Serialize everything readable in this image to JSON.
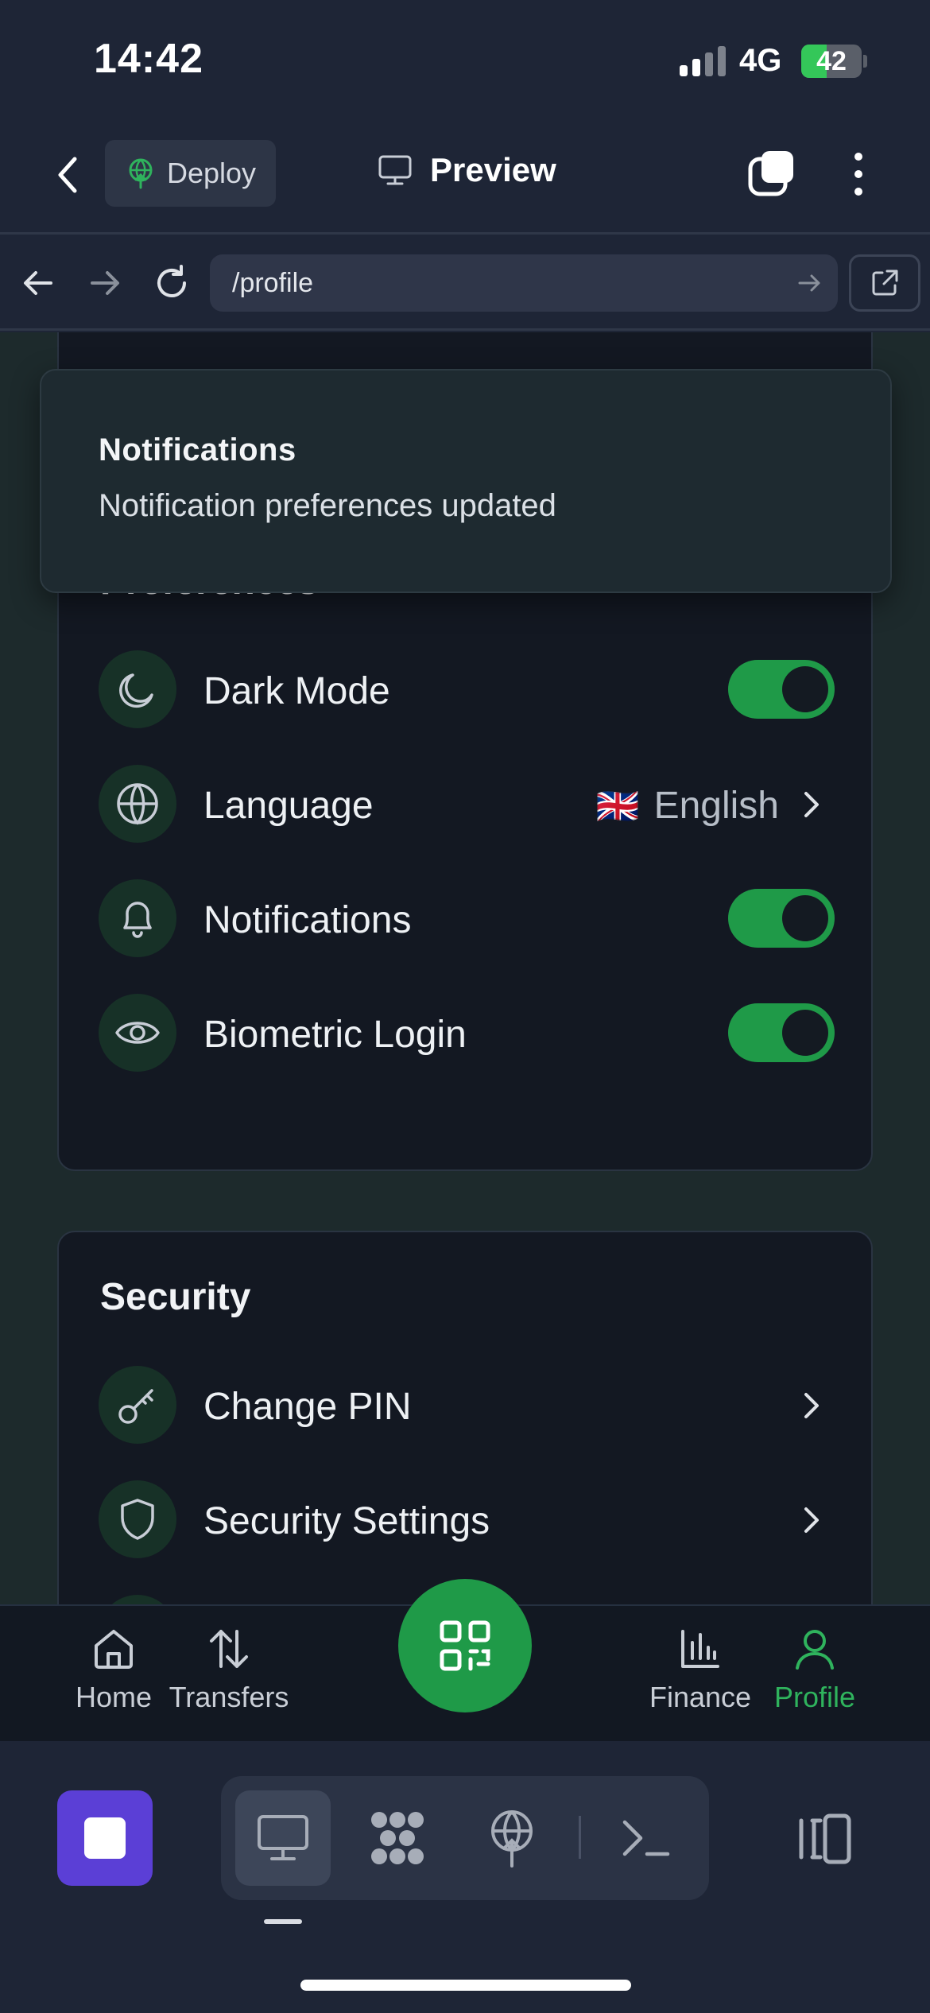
{
  "status_bar": {
    "time": "14:42",
    "network": "4G",
    "battery": "42"
  },
  "header": {
    "deploy_label": "Deploy",
    "preview_label": "Preview"
  },
  "browser": {
    "url": "/profile"
  },
  "toast": {
    "title": "Notifications",
    "message": "Notification preferences updated"
  },
  "preferences": {
    "title": "Preferences",
    "items": [
      {
        "label": "Dark Mode",
        "icon": "moon-icon",
        "control": "toggle",
        "on": true
      },
      {
        "label": "Language",
        "icon": "globe-icon",
        "value": "English",
        "flag": "🇬🇧",
        "control": "chevron"
      },
      {
        "label": "Notifications",
        "icon": "bell-icon",
        "control": "toggle",
        "on": true
      },
      {
        "label": "Biometric Login",
        "icon": "eye-icon",
        "control": "toggle",
        "on": true
      }
    ]
  },
  "security": {
    "title": "Security",
    "items": [
      {
        "label": "Change PIN",
        "icon": "key-icon",
        "control": "chevron"
      },
      {
        "label": "Security Settings",
        "icon": "shield-icon",
        "control": "chevron"
      }
    ]
  },
  "bottom_nav": {
    "items": [
      {
        "label": "Home",
        "icon": "home-icon"
      },
      {
        "label": "Transfers",
        "icon": "transfer-arrows-icon"
      },
      {
        "label": "Finance",
        "icon": "bar-chart-icon"
      },
      {
        "label": "Profile",
        "icon": "user-icon",
        "active": true
      }
    ],
    "center_action": "qr-code-icon"
  },
  "colors": {
    "accent": "#1f9a48",
    "active_label": "#2fb35d",
    "stop_button": "#5b3fd6"
  }
}
